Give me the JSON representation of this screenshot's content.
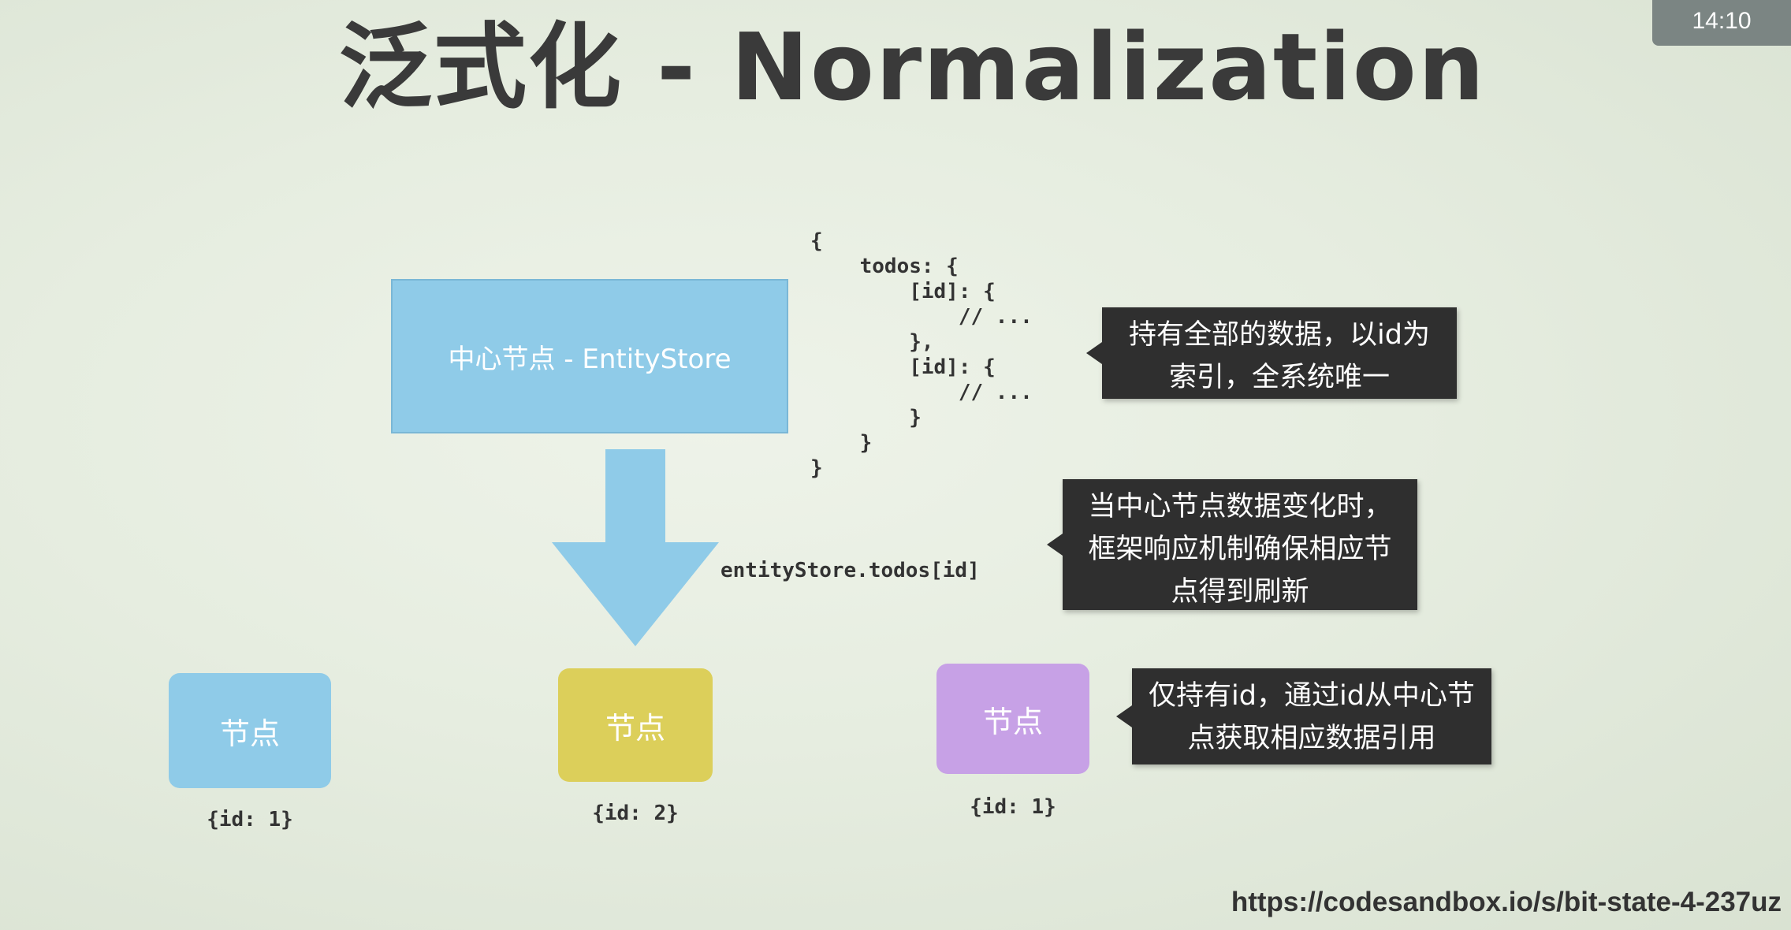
{
  "title": "泛式化 - Normalization",
  "clock": "14:10",
  "entity_store": {
    "label": "中心节点 - EntityStore"
  },
  "code": {
    "store_shape": "{\n    todos: {\n        [id]: {\n            // ...\n        },\n        [id]: {\n            // ...\n        }\n    }\n}",
    "access_expression": "entityStore.todos[id]"
  },
  "callouts": [
    "持有全部的数据，以id为\n索引，全系统唯一",
    "当中心节点数据变化时，\n框架响应机制确保相应节\n点得到刷新",
    "仅持有id，通过id从中心节\n点获取相应数据引用"
  ],
  "nodes": [
    {
      "label": "节点",
      "id_text": "{id: 1}"
    },
    {
      "label": "节点",
      "id_text": "{id: 2}"
    },
    {
      "label": "节点",
      "id_text": "{id: 1}"
    }
  ],
  "colors": {
    "entity_store": "#8fcbe8",
    "node_1": "#8fcbe8",
    "node_2": "#dccf5a",
    "node_3": "#c7a1e6",
    "callout": "#2f2f2f",
    "arrow": "#8fcbe8"
  },
  "footer_url": "https://codesandbox.io/s/bit-state-4-237uz"
}
